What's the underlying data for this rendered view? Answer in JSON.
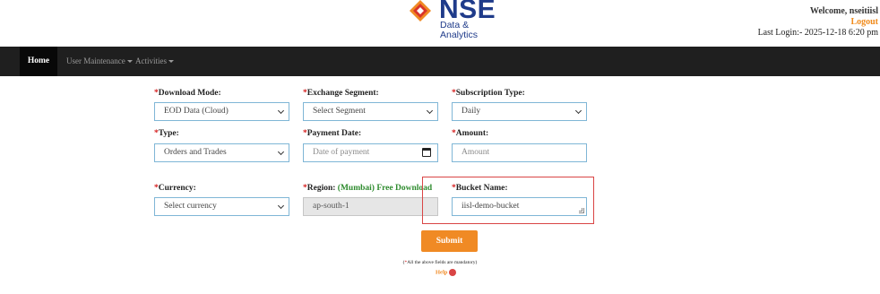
{
  "header": {
    "logo_text": "NSE",
    "logo_sub_line1": "Data &",
    "logo_sub_line2": "Analytics",
    "welcome": "Welcome, nseitiisl",
    "logout": "Logout",
    "last_login": "Last Login:- 2025-12-18 6:20 pm"
  },
  "nav": {
    "home": "Home",
    "user_maintenance": "User Maintenance",
    "activities": "Activities"
  },
  "form": {
    "download_mode": {
      "label": "Download Mode:",
      "value": "EOD Data (Cloud)"
    },
    "exchange_segment": {
      "label": "Exchange Segment:",
      "value": "Select Segment"
    },
    "subscription_type": {
      "label": "Subscription Type:",
      "value": "Daily"
    },
    "type": {
      "label": "Type:",
      "value": "Orders and Trades"
    },
    "payment_date": {
      "label": "Payment Date:",
      "placeholder": "Date of payment"
    },
    "amount": {
      "label": "Amount:",
      "placeholder": "Amount"
    },
    "currency": {
      "label": "Currency:",
      "value": "Select currency"
    },
    "region": {
      "label": "Region:",
      "label_note": "(Mumbai) Free Download",
      "value": "ap-south-1"
    },
    "bucket_name": {
      "label": "Bucket Name:",
      "value": "iisl-demo-bucket"
    },
    "required_mark": "*"
  },
  "actions": {
    "submit": "Submit",
    "note_prefix": "(",
    "note_star": "*",
    "note_text": "All the above fields are mandatory)",
    "help": "Help"
  },
  "colors": {
    "accent_orange": "#f08a24",
    "navbar": "#1f1f1f",
    "brand_blue": "#1f3b8a",
    "required_red": "#d62020",
    "highlight_red": "#d94545"
  }
}
